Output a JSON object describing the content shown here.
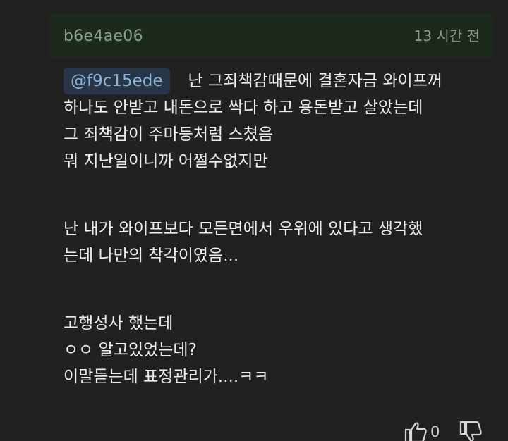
{
  "comment": {
    "author": "b6e4ae06",
    "timestamp": "13 시간 전",
    "mention": "@f9c15ede",
    "first_line_text": "난 그죄책감때문에 결혼자금 와이프꺼",
    "lines": [
      "하나도 안받고 내돈으로 싹다 하고 용돈받고 살았는데",
      "그 죄책감이 주마등처럼 스쳤음",
      "뭐 지난일이니까 어쩔수없지만",
      "난 내가 와이프보다 모든면에서 우위에 있다고 생각했",
      "는데 나만의 착각이였음...",
      "고행성사 했는데",
      "ㅇㅇ 알고있었는데?",
      "이말듣는데 표정관리가....ㅋㅋ"
    ],
    "like_count": "0",
    "icons": {
      "like": "thumbs-up-icon",
      "dislike": "thumbs-down-icon"
    },
    "colors": {
      "background": "#212121",
      "header_background": "#1c2a1e",
      "mention_background": "#263646",
      "mention_text": "#8fb2d8",
      "author_text": "#87a088"
    }
  }
}
